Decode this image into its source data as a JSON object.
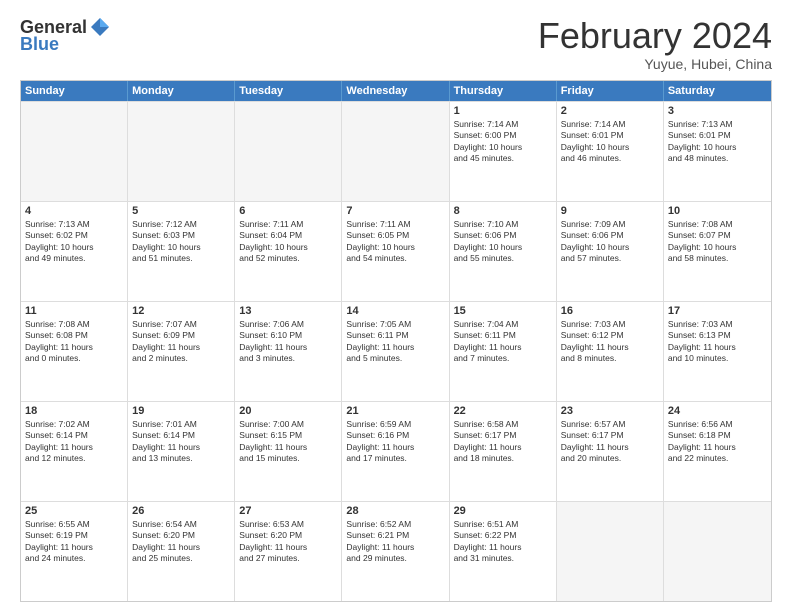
{
  "logo": {
    "general": "General",
    "blue": "Blue"
  },
  "header": {
    "month": "February 2024",
    "location": "Yuyue, Hubei, China"
  },
  "days": [
    "Sunday",
    "Monday",
    "Tuesday",
    "Wednesday",
    "Thursday",
    "Friday",
    "Saturday"
  ],
  "rows": [
    [
      {
        "day": "",
        "lines": []
      },
      {
        "day": "",
        "lines": []
      },
      {
        "day": "",
        "lines": []
      },
      {
        "day": "",
        "lines": []
      },
      {
        "day": "1",
        "lines": [
          "Sunrise: 7:14 AM",
          "Sunset: 6:00 PM",
          "Daylight: 10 hours",
          "and 45 minutes."
        ]
      },
      {
        "day": "2",
        "lines": [
          "Sunrise: 7:14 AM",
          "Sunset: 6:01 PM",
          "Daylight: 10 hours",
          "and 46 minutes."
        ]
      },
      {
        "day": "3",
        "lines": [
          "Sunrise: 7:13 AM",
          "Sunset: 6:01 PM",
          "Daylight: 10 hours",
          "and 48 minutes."
        ]
      }
    ],
    [
      {
        "day": "4",
        "lines": [
          "Sunrise: 7:13 AM",
          "Sunset: 6:02 PM",
          "Daylight: 10 hours",
          "and 49 minutes."
        ]
      },
      {
        "day": "5",
        "lines": [
          "Sunrise: 7:12 AM",
          "Sunset: 6:03 PM",
          "Daylight: 10 hours",
          "and 51 minutes."
        ]
      },
      {
        "day": "6",
        "lines": [
          "Sunrise: 7:11 AM",
          "Sunset: 6:04 PM",
          "Daylight: 10 hours",
          "and 52 minutes."
        ]
      },
      {
        "day": "7",
        "lines": [
          "Sunrise: 7:11 AM",
          "Sunset: 6:05 PM",
          "Daylight: 10 hours",
          "and 54 minutes."
        ]
      },
      {
        "day": "8",
        "lines": [
          "Sunrise: 7:10 AM",
          "Sunset: 6:06 PM",
          "Daylight: 10 hours",
          "and 55 minutes."
        ]
      },
      {
        "day": "9",
        "lines": [
          "Sunrise: 7:09 AM",
          "Sunset: 6:06 PM",
          "Daylight: 10 hours",
          "and 57 minutes."
        ]
      },
      {
        "day": "10",
        "lines": [
          "Sunrise: 7:08 AM",
          "Sunset: 6:07 PM",
          "Daylight: 10 hours",
          "and 58 minutes."
        ]
      }
    ],
    [
      {
        "day": "11",
        "lines": [
          "Sunrise: 7:08 AM",
          "Sunset: 6:08 PM",
          "Daylight: 11 hours",
          "and 0 minutes."
        ]
      },
      {
        "day": "12",
        "lines": [
          "Sunrise: 7:07 AM",
          "Sunset: 6:09 PM",
          "Daylight: 11 hours",
          "and 2 minutes."
        ]
      },
      {
        "day": "13",
        "lines": [
          "Sunrise: 7:06 AM",
          "Sunset: 6:10 PM",
          "Daylight: 11 hours",
          "and 3 minutes."
        ]
      },
      {
        "day": "14",
        "lines": [
          "Sunrise: 7:05 AM",
          "Sunset: 6:11 PM",
          "Daylight: 11 hours",
          "and 5 minutes."
        ]
      },
      {
        "day": "15",
        "lines": [
          "Sunrise: 7:04 AM",
          "Sunset: 6:11 PM",
          "Daylight: 11 hours",
          "and 7 minutes."
        ]
      },
      {
        "day": "16",
        "lines": [
          "Sunrise: 7:03 AM",
          "Sunset: 6:12 PM",
          "Daylight: 11 hours",
          "and 8 minutes."
        ]
      },
      {
        "day": "17",
        "lines": [
          "Sunrise: 7:03 AM",
          "Sunset: 6:13 PM",
          "Daylight: 11 hours",
          "and 10 minutes."
        ]
      }
    ],
    [
      {
        "day": "18",
        "lines": [
          "Sunrise: 7:02 AM",
          "Sunset: 6:14 PM",
          "Daylight: 11 hours",
          "and 12 minutes."
        ]
      },
      {
        "day": "19",
        "lines": [
          "Sunrise: 7:01 AM",
          "Sunset: 6:14 PM",
          "Daylight: 11 hours",
          "and 13 minutes."
        ]
      },
      {
        "day": "20",
        "lines": [
          "Sunrise: 7:00 AM",
          "Sunset: 6:15 PM",
          "Daylight: 11 hours",
          "and 15 minutes."
        ]
      },
      {
        "day": "21",
        "lines": [
          "Sunrise: 6:59 AM",
          "Sunset: 6:16 PM",
          "Daylight: 11 hours",
          "and 17 minutes."
        ]
      },
      {
        "day": "22",
        "lines": [
          "Sunrise: 6:58 AM",
          "Sunset: 6:17 PM",
          "Daylight: 11 hours",
          "and 18 minutes."
        ]
      },
      {
        "day": "23",
        "lines": [
          "Sunrise: 6:57 AM",
          "Sunset: 6:17 PM",
          "Daylight: 11 hours",
          "and 20 minutes."
        ]
      },
      {
        "day": "24",
        "lines": [
          "Sunrise: 6:56 AM",
          "Sunset: 6:18 PM",
          "Daylight: 11 hours",
          "and 22 minutes."
        ]
      }
    ],
    [
      {
        "day": "25",
        "lines": [
          "Sunrise: 6:55 AM",
          "Sunset: 6:19 PM",
          "Daylight: 11 hours",
          "and 24 minutes."
        ]
      },
      {
        "day": "26",
        "lines": [
          "Sunrise: 6:54 AM",
          "Sunset: 6:20 PM",
          "Daylight: 11 hours",
          "and 25 minutes."
        ]
      },
      {
        "day": "27",
        "lines": [
          "Sunrise: 6:53 AM",
          "Sunset: 6:20 PM",
          "Daylight: 11 hours",
          "and 27 minutes."
        ]
      },
      {
        "day": "28",
        "lines": [
          "Sunrise: 6:52 AM",
          "Sunset: 6:21 PM",
          "Daylight: 11 hours",
          "and 29 minutes."
        ]
      },
      {
        "day": "29",
        "lines": [
          "Sunrise: 6:51 AM",
          "Sunset: 6:22 PM",
          "Daylight: 11 hours",
          "and 31 minutes."
        ]
      },
      {
        "day": "",
        "lines": []
      },
      {
        "day": "",
        "lines": []
      }
    ]
  ]
}
